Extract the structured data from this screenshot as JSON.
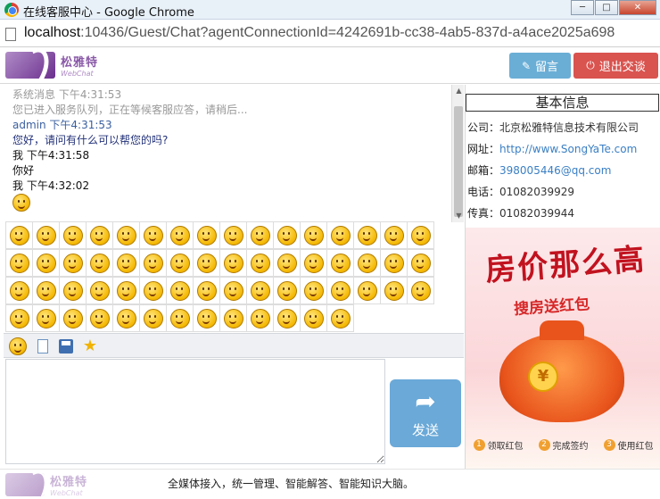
{
  "window": {
    "title": "在线客服中心 - Google Chrome",
    "minimize": "─",
    "maximize": "□",
    "close": "✕"
  },
  "address": {
    "host": "localhost",
    "path": ":10436/Guest/Chat?agentConnectionId=4242691b-cc38-4ab5-837d-a4ace2025a698"
  },
  "header": {
    "logo_cn": "松雅特",
    "logo_en": "WebChat",
    "leave_message_label": "留言",
    "exit_chat_label": "退出交谈"
  },
  "messages": [
    {
      "type": "sys",
      "text": "系统消息  下午4:31:53"
    },
    {
      "type": "sys",
      "text": "您已进入服务队列，正在等候客服应答，请稍后..."
    },
    {
      "type": "agent-name",
      "text": "admin  下午4:31:53"
    },
    {
      "type": "agent-text",
      "text": "您好，请问有什么可以帮您的吗?"
    },
    {
      "type": "me",
      "text": "我 下午4:31:58"
    },
    {
      "type": "me",
      "text": "你好"
    },
    {
      "type": "me",
      "text": "我 下午4:32:02"
    }
  ],
  "emoji_rows": [
    16,
    16,
    16,
    13
  ],
  "toolbar": {
    "emoji": "emoji-icon",
    "file": "file-icon",
    "save": "save-icon",
    "favorite": "star-icon"
  },
  "input": {
    "placeholder": "",
    "send_label": "发送"
  },
  "info": {
    "title": "基本信息",
    "company_label": "公司：",
    "company": "北京松雅特信息技术有限公司",
    "website_label": "网址：",
    "website": "http://www.SongYaTe.com",
    "email_label": "邮箱：",
    "email": "398005446@qq.com",
    "phone_label": "电话：",
    "phone": "01082039929",
    "fax_label": "传真：",
    "fax": "01082039944"
  },
  "ad": {
    "headline": "房价那么高",
    "subline": "搜房送红包",
    "coin": "¥",
    "steps": [
      "领取红包",
      "完成签约",
      "使用红包"
    ]
  },
  "footer": {
    "logo_cn": "松雅特",
    "logo_en": "WebChat",
    "slogan": "全媒体接入，统一管理、智能解答、智能知识大脑。"
  },
  "colors": {
    "leave_btn": "#6aaed6",
    "exit_btn": "#d9534f",
    "send_btn": "#6aa9d8",
    "brand": "#8a5aa8"
  }
}
